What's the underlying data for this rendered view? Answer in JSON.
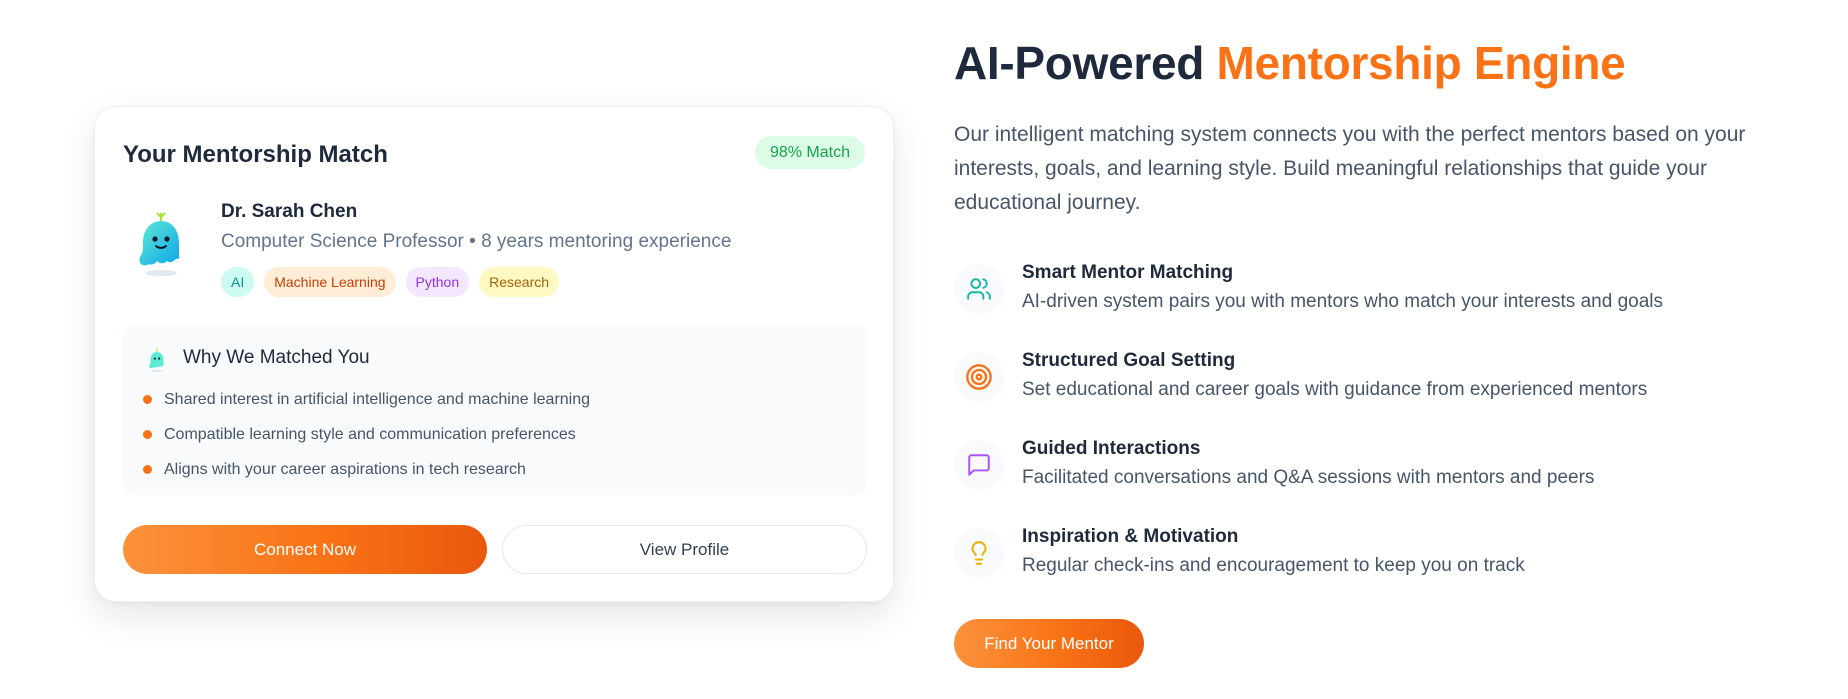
{
  "card": {
    "title": "Your Mentorship Match",
    "match_badge": "98% Match",
    "mentor": {
      "name": "Dr. Sarah Chen",
      "subtitle": "Computer Science Professor • 8 years mentoring experience",
      "avatar_icon": "ghost-mascot-icon"
    },
    "tags": [
      "AI",
      "Machine Learning",
      "Python",
      "Research"
    ],
    "why": {
      "title": "Why We Matched You",
      "reasons": [
        "Shared interest in artificial intelligence and machine learning",
        "Compatible learning style and communication preferences",
        "Aligns with your career aspirations in tech research"
      ]
    },
    "connect_label": "Connect Now",
    "view_profile_label": "View Profile"
  },
  "hero": {
    "title_main": "AI-Powered ",
    "title_accent": "Mentorship Engine",
    "description": "Our intelligent matching system connects you with the perfect mentors based on your interests, goals, and learning style. Build meaningful relationships that guide your educational journey.",
    "cta_label": "Find Your Mentor"
  },
  "features": [
    {
      "title": "Smart Mentor Matching",
      "desc": "AI-driven system pairs you with mentors who match your interests and goals",
      "icon": "users-icon",
      "color": "#14b8a6"
    },
    {
      "title": "Structured Goal Setting",
      "desc": "Set educational and career goals with guidance from experienced mentors",
      "icon": "target-icon",
      "color": "#f97316"
    },
    {
      "title": "Guided Interactions",
      "desc": "Facilitated conversations and Q&A sessions with mentors and peers",
      "icon": "message-square-icon",
      "color": "#a855f7"
    },
    {
      "title": "Inspiration & Motivation",
      "desc": "Regular check-ins and encouragement to keep you on track",
      "icon": "lightbulb-icon",
      "color": "#eab308"
    }
  ],
  "colors": {
    "accent": "#f97316",
    "text_dark": "#1e293b",
    "text_muted": "#475569",
    "match_green": "#16a34a"
  }
}
